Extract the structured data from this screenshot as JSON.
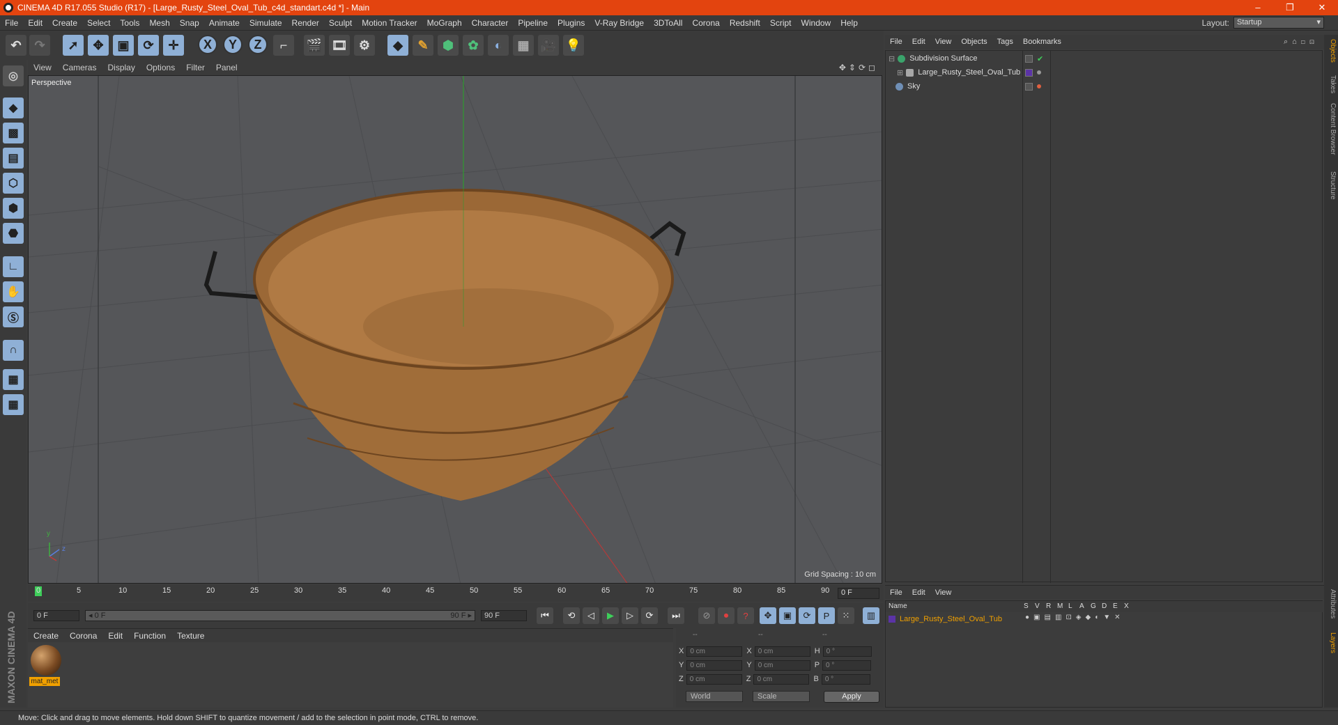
{
  "window": {
    "title": "CINEMA 4D R17.055 Studio (R17) - [Large_Rusty_Steel_Oval_Tub_c4d_standart.c4d *] - Main",
    "controls": [
      "–",
      "❐",
      "✕"
    ]
  },
  "menu": [
    "File",
    "Edit",
    "Create",
    "Select",
    "Tools",
    "Mesh",
    "Snap",
    "Animate",
    "Simulate",
    "Render",
    "Sculpt",
    "Motion Tracker",
    "MoGraph",
    "Character",
    "Pipeline",
    "Plugins",
    "V-Ray Bridge",
    "3DToAll",
    "Corona",
    "Redshift",
    "Script",
    "Window",
    "Help"
  ],
  "layout": {
    "label": "Layout:",
    "value": "Startup"
  },
  "toolbar": {
    "axes": [
      "X",
      "Y",
      "Z"
    ]
  },
  "viewport": {
    "menu": [
      "View",
      "Cameras",
      "Display",
      "Options",
      "Filter",
      "Panel"
    ],
    "camera_label": "Perspective",
    "grid_spacing": "Grid Spacing : 10 cm",
    "axis_y": "y",
    "axis_z": "z"
  },
  "timeline": {
    "ticks": [
      "0",
      "5",
      "10",
      "15",
      "20",
      "25",
      "30",
      "35",
      "40",
      "45",
      "50",
      "55",
      "60",
      "65",
      "70",
      "75",
      "80",
      "85",
      "90"
    ],
    "current_frame": "0 F",
    "start_field": "0 F",
    "range_start": "◂ 0 F",
    "range_end": "90 F ▸",
    "end_field": "90 F"
  },
  "material_manager": {
    "menu": [
      "Create",
      "Corona",
      "Edit",
      "Function",
      "Texture"
    ],
    "materials": [
      {
        "name": "mat_met"
      }
    ]
  },
  "coordinates": {
    "headers": [
      "--",
      "--",
      "--"
    ],
    "rows": [
      {
        "a": "X",
        "av": "0 cm",
        "b": "X",
        "bv": "0 cm",
        "c": "H",
        "cv": "0 °"
      },
      {
        "a": "Y",
        "av": "0 cm",
        "b": "Y",
        "bv": "0 cm",
        "c": "P",
        "cv": "0 °"
      },
      {
        "a": "Z",
        "av": "0 cm",
        "b": "Z",
        "bv": "0 cm",
        "c": "B",
        "cv": "0 °"
      }
    ],
    "space": "World",
    "mode": "Scale",
    "apply": "Apply"
  },
  "object_manager": {
    "menu": [
      "File",
      "Edit",
      "View",
      "Objects",
      "Tags",
      "Bookmarks"
    ],
    "objects": [
      {
        "name": "Subdivision Surface",
        "color": "#3aa36b"
      },
      {
        "name": "Large_Rusty_Steel_Oval_Tub",
        "color": "#a8a8a8"
      },
      {
        "name": "Sky",
        "color": "#6f8fb6"
      }
    ]
  },
  "right_tabs": [
    "Objects",
    "Takes",
    "Content Browser",
    "Structure",
    "Attributes",
    "Layers"
  ],
  "layers_manager": {
    "menu": [
      "File",
      "Edit",
      "View"
    ],
    "columns": [
      "Name",
      "S",
      "V",
      "R",
      "M",
      "L",
      "A",
      "G",
      "D",
      "E",
      "X"
    ],
    "layers": [
      {
        "name": "Large_Rusty_Steel_Oval_Tub",
        "color": "#5b33a6"
      }
    ]
  },
  "logo": "MAXON CINEMA 4D",
  "status": "Move: Click and drag to move elements. Hold down SHIFT to quantize movement / add to the selection in point mode, CTRL to remove."
}
